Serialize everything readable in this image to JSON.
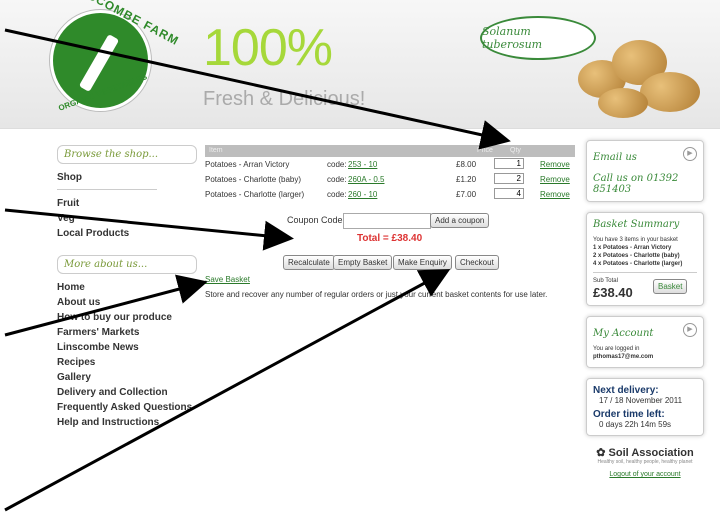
{
  "logo": {
    "top": "LINSCOMBE FARM",
    "bottom": "ORGANIC VEGETABLES"
  },
  "hero": {
    "big": "100%",
    "sub": "Fresh & Delicious!",
    "latin": "Solanum tuberosum"
  },
  "left": {
    "browse_title": "Browse the shop...",
    "shop": "Shop",
    "shop_items": [
      "Fruit",
      "Veg",
      "Local Products"
    ],
    "more_title": "More about us...",
    "more_items": [
      "Home",
      "About us",
      "How to buy our produce",
      "Farmers' Markets",
      "Linscombe News",
      "Recipes",
      "Gallery",
      "Delivery and Collection",
      "Frequently Asked Questions",
      "Help and Instructions"
    ]
  },
  "basket": {
    "headers": {
      "item": "Item",
      "price": "Price",
      "qty": "Qty"
    },
    "rows": [
      {
        "name": "Potatoes - Arran Victory",
        "code_label": "code:",
        "code": "253 - 10",
        "price": "£8.00",
        "qty": "1",
        "remove": "Remove"
      },
      {
        "name": "Potatoes - Charlotte (baby)",
        "code_label": "code:",
        "code": "260A - 0.5",
        "price": "£1.20",
        "qty": "2",
        "remove": "Remove"
      },
      {
        "name": "Potatoes - Charlotte (larger)",
        "code_label": "code:",
        "code": "260 - 10",
        "price": "£7.00",
        "qty": "4",
        "remove": "Remove"
      }
    ],
    "coupon_label": "Coupon Code",
    "coupon_value": "",
    "add_coupon": "Add a coupon",
    "total": "Total = £38.40",
    "buttons": {
      "recalculate": "Recalculate",
      "empty": "Empty Basket",
      "enquiry": "Make Enquiry",
      "checkout": "Checkout"
    },
    "save": "Save Basket",
    "store_text": "Store and recover any number of regular orders or just your current basket contents for use later."
  },
  "right": {
    "email": "Email us",
    "call": "Call us on 01392 851403",
    "summary_title": "Basket Summary",
    "summary_intro": "You have 3 items in your basket",
    "summary_items": [
      "1 x Potatoes - Arran Victory",
      "2 x Potatoes - Charlotte (baby)",
      "4 x Potatoes - Charlotte (larger)"
    ],
    "subtotal_label": "Sub Total",
    "subtotal": "£38.40",
    "basket_btn": "Basket",
    "account_title": "My Account",
    "logged": "You are logged in",
    "email_addr": "pthomas17@me.com",
    "next_label": "Next delivery:",
    "next_val": "17 / 18 November 2011",
    "order_label": "Order time left:",
    "order_val": "0 days 22h 14m 59s",
    "soil": "Soil Association",
    "soil_tag": "Healthy soil, healthy people, healthy planet",
    "logout": "Logout of your account"
  }
}
